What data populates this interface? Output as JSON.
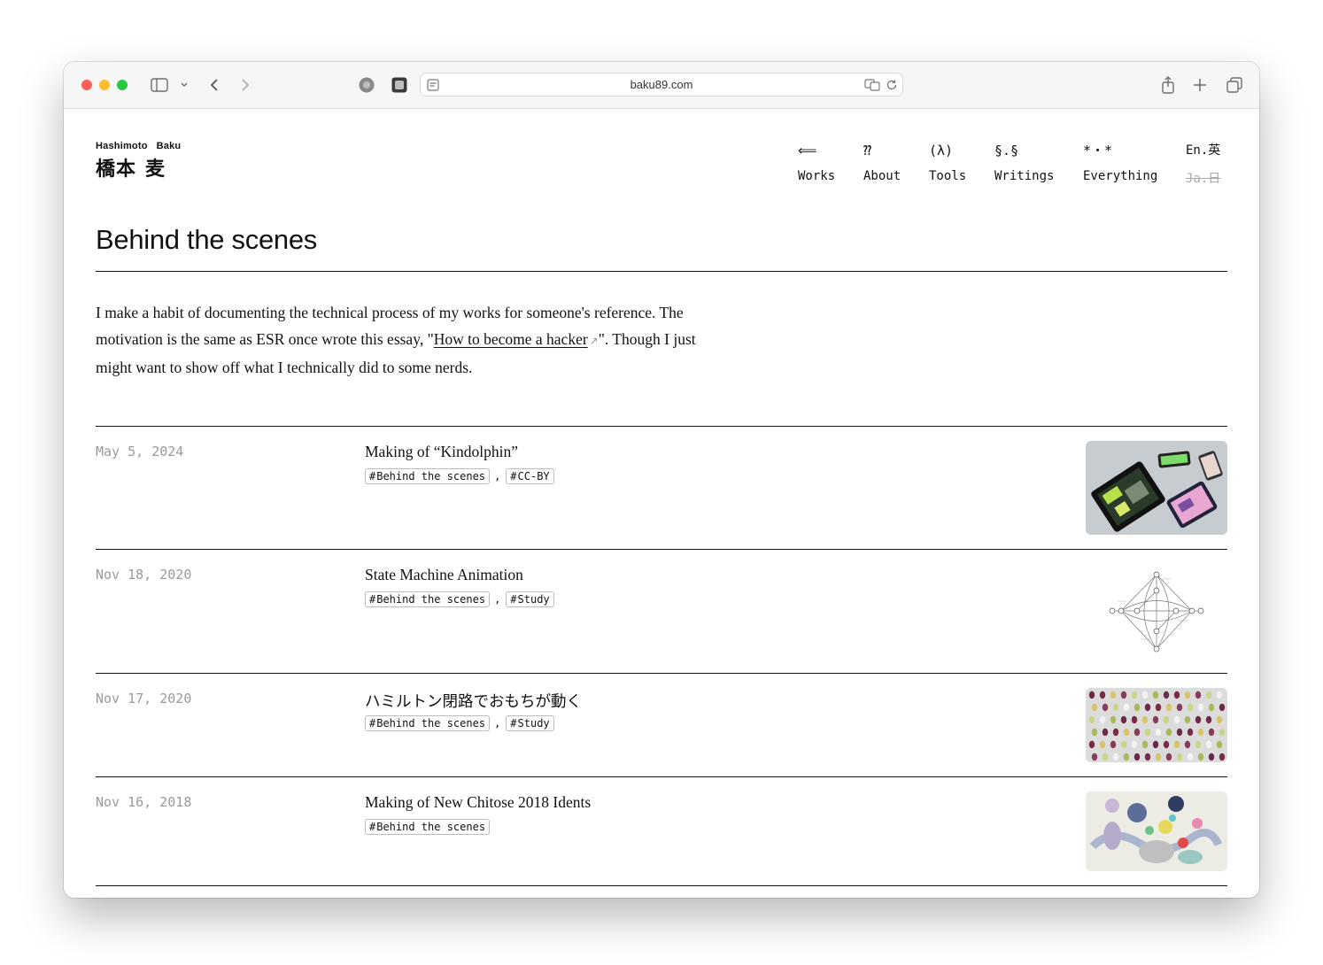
{
  "browser": {
    "url": "baku89.com"
  },
  "header": {
    "name_en": [
      "Hashimoto",
      "Baku"
    ],
    "name_ja": [
      "橋本",
      "麦"
    ],
    "nav": [
      {
        "glyph": "⟸",
        "label": "Works"
      },
      {
        "glyph": "⁇",
        "label": "About"
      },
      {
        "glyph": "(λ)",
        "label": "Tools"
      },
      {
        "glyph": "§.§",
        "label": "Writings"
      },
      {
        "glyph": "*・*",
        "label": "Everything"
      }
    ],
    "lang_current": "En.英",
    "lang_alt": "Ja.日"
  },
  "page": {
    "title": "Behind the scenes",
    "intro_before": "I make a habit of documenting the technical process of my works for someone's reference. The motivation is the same as ESR once wrote this essay, \"",
    "intro_link": "How to become a hacker",
    "intro_after": "\". Though I just might want to show off what I technically did to some nerds."
  },
  "entries": [
    {
      "date": "May 5, 2024",
      "title": "Making of “Kindolphin”",
      "tags": [
        "Behind the scenes",
        "CC-BY"
      ],
      "thumb": "kindolphin-devices-photo"
    },
    {
      "date": "Nov 18, 2020",
      "title": "State Machine Animation",
      "tags": [
        "Behind the scenes",
        "Study"
      ],
      "thumb": "state-machine-graph"
    },
    {
      "date": "Nov 17, 2020",
      "title": "ハミルトン閉路でおもちが動く",
      "tags": [
        "Behind the scenes",
        "Study"
      ],
      "thumb": "mochi-grid"
    },
    {
      "date": "Nov 16, 2018",
      "title": "Making of New Chitose 2018 Idents",
      "tags": [
        "Behind the scenes"
      ],
      "thumb": "abstract-shapes"
    }
  ]
}
